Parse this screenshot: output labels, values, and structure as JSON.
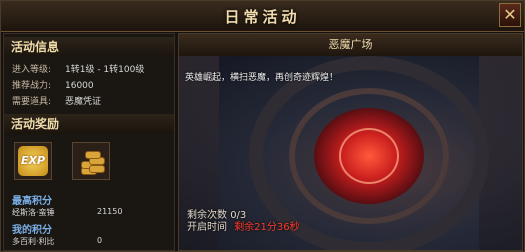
{
  "window": {
    "title": "日常活动",
    "close_label": "✕"
  },
  "activity_info": {
    "header": "活动信息",
    "rows": [
      {
        "label": "进入等级:",
        "value": "1转1级 - 1转100级"
      },
      {
        "label": "推荐战力:",
        "value": "16000"
      },
      {
        "label": "需要道具:",
        "value": "恶魔凭证"
      }
    ]
  },
  "rewards": {
    "header": "活动奖励",
    "items": [
      {
        "icon": "exp-icon",
        "label": "EXP"
      },
      {
        "icon": "gold-coins-icon",
        "label": ""
      }
    ]
  },
  "highest_score": {
    "label": "最高积分",
    "player": "经斯洛·蛮锤",
    "value": "21150"
  },
  "my_score": {
    "label": "我的积分",
    "player": "多百利·利比",
    "value": "0"
  },
  "scene": {
    "title": "恶魔广场",
    "description": "英雄崛起，横扫恶魔，再创奇迹辉煌！",
    "remaining_label": "剩余次数",
    "remaining_value": "0/3",
    "open_time_label": "开启时间",
    "countdown": "剩余21分36秒"
  }
}
